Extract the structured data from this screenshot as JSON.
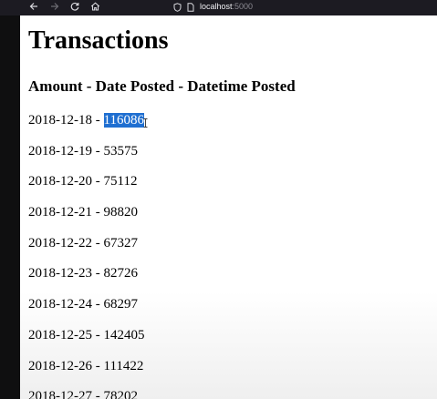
{
  "browser": {
    "url_host": "localhost",
    "url_port": ":5000"
  },
  "page": {
    "title": "Transactions",
    "subtitle": "Amount - Date Posted - Datetime Posted",
    "rows": [
      {
        "date": "2018-12-18",
        "amount": "116086",
        "selected": true
      },
      {
        "date": "2018-12-19",
        "amount": "53575"
      },
      {
        "date": "2018-12-20",
        "amount": "75112"
      },
      {
        "date": "2018-12-21",
        "amount": "98820"
      },
      {
        "date": "2018-12-22",
        "amount": "67327"
      },
      {
        "date": "2018-12-23",
        "amount": "82726"
      },
      {
        "date": "2018-12-24",
        "amount": "68297"
      },
      {
        "date": "2018-12-25",
        "amount": "142405"
      },
      {
        "date": "2018-12-26",
        "amount": "111422"
      },
      {
        "date": "2018-12-27",
        "amount": "78202"
      }
    ],
    "separator": " - "
  },
  "colors": {
    "selection": "#1f6fd1",
    "toolbar": "#1c1b22"
  }
}
